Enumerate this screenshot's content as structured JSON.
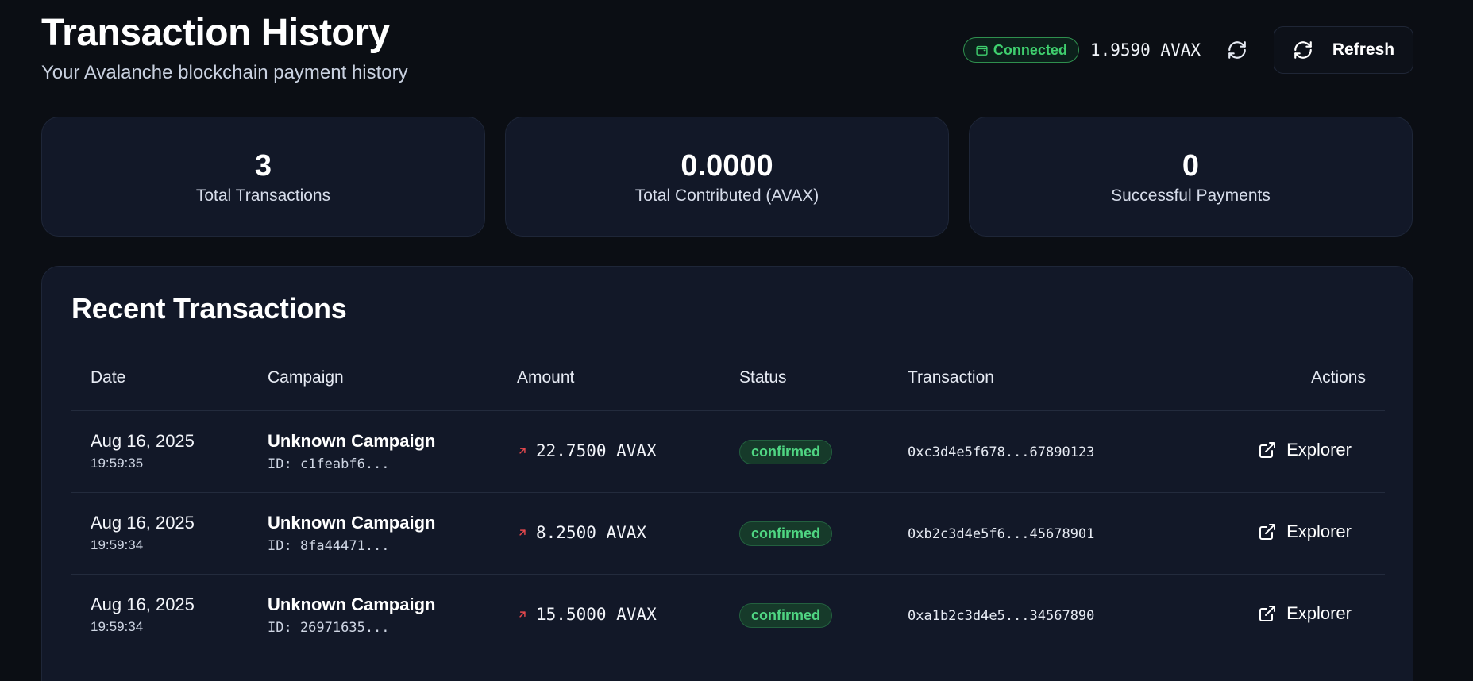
{
  "header": {
    "title": "Transaction History",
    "subtitle": "Your Avalanche blockchain payment history",
    "connection_status": "Connected",
    "balance": "1.9590 AVAX",
    "refresh_label": "Refresh"
  },
  "stats": [
    {
      "value": "3",
      "label": "Total Transactions"
    },
    {
      "value": "0.0000",
      "label": "Total Contributed (AVAX)"
    },
    {
      "value": "0",
      "label": "Successful Payments"
    }
  ],
  "transactions": {
    "title": "Recent Transactions",
    "columns": {
      "date": "Date",
      "campaign": "Campaign",
      "amount": "Amount",
      "status": "Status",
      "transaction": "Transaction",
      "actions": "Actions"
    },
    "rows": [
      {
        "date": "Aug 16, 2025",
        "time": "19:59:35",
        "campaign": "Unknown Campaign",
        "campaign_id": "ID: c1feabf6...",
        "amount": "22.7500 AVAX",
        "status": "confirmed",
        "hash": "0xc3d4e5f678...67890123",
        "action": "Explorer"
      },
      {
        "date": "Aug 16, 2025",
        "time": "19:59:34",
        "campaign": "Unknown Campaign",
        "campaign_id": "ID: 8fa44471...",
        "amount": "8.2500 AVAX",
        "status": "confirmed",
        "hash": "0xb2c3d4e5f6...45678901",
        "action": "Explorer"
      },
      {
        "date": "Aug 16, 2025",
        "time": "19:59:34",
        "campaign": "Unknown Campaign",
        "campaign_id": "ID: 26971635...",
        "amount": "15.5000 AVAX",
        "status": "confirmed",
        "hash": "0xa1b2c3d4e5...34567890",
        "action": "Explorer"
      }
    ]
  },
  "colors": {
    "background": "#0b0e14",
    "card": "#121828",
    "success": "#3fcf6e",
    "outgoing_arrow": "#e5484d"
  }
}
